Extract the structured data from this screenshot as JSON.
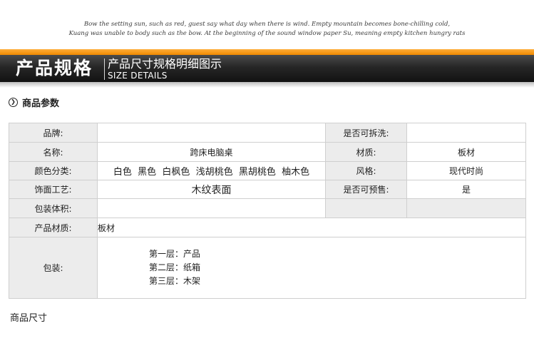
{
  "header": {
    "tagline_lines": [
      "Bow the setting sun, such as red, guest say what day when there is wind. Empty mountain becomes bone-chilling cold,",
      "Kuang was unable to body such as the bow. At the beginning of the sound window paper  Su, meaning empty kitchen hungry rats"
    ],
    "banner_title": "产品规格",
    "banner_subtitle_cn": "产品尺寸规格明细图示",
    "banner_subtitle_en": "SIZE DETAILS"
  },
  "section": {
    "title": "商品参数",
    "icon": "circle-chevron-right-icon"
  },
  "table": {
    "rows": [
      {
        "label": "品牌:",
        "value": "",
        "label2": "是否可拆洗:",
        "value2": ""
      },
      {
        "label": "名称:",
        "value": "跨床电脑桌",
        "label2": "材质:",
        "value2": "板材"
      },
      {
        "label": "颜色分类:",
        "value": "白色  黑色  白枫色  浅胡桃色  黑胡桃色  柚木色",
        "label2": "风格:",
        "value2": "现代时尚"
      },
      {
        "label": "饰面工艺:",
        "value": "木纹表面",
        "label2": "是否可预售:",
        "value2": "是"
      },
      {
        "label": "包装体积:",
        "value": "",
        "label2": "",
        "value2": ""
      }
    ],
    "material": {
      "label": "产品材质:",
      "value": "板材"
    },
    "packaging": {
      "label": "包装:",
      "lines": [
        "第一层：产品",
        "第二层：纸箱",
        "第三层：木架"
      ]
    }
  },
  "footer": {
    "text": "商品尺寸"
  },
  "colors": {
    "orange": "#f08a00",
    "banner_dark": "#1a1a1a",
    "label_bg": "#ececec",
    "border": "#cfcfcf"
  }
}
